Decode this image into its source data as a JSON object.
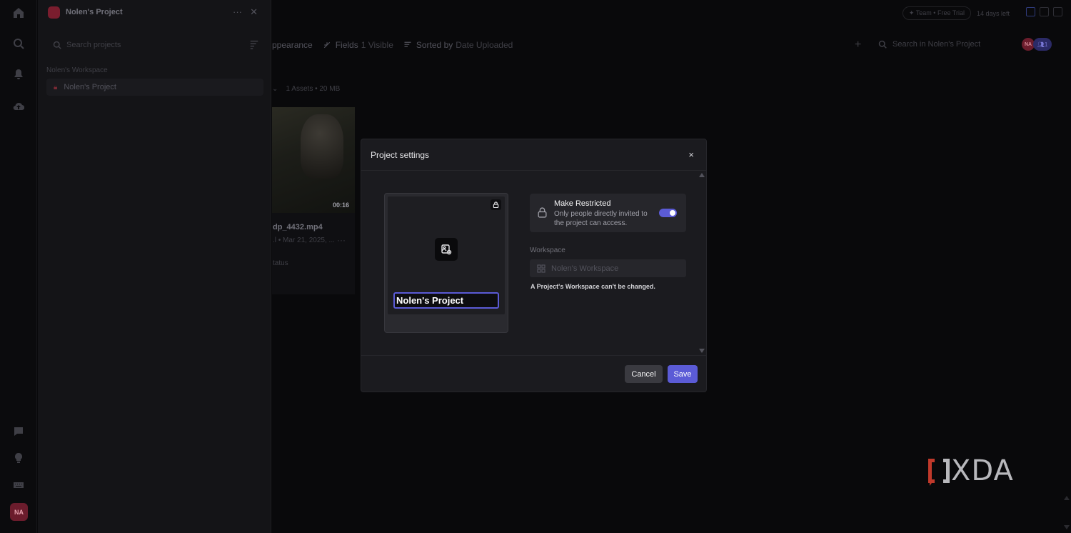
{
  "sidebar": {
    "project_title": "Nolen's Project",
    "search_placeholder": "Search projects",
    "workspace_label": "Nolen's Workspace",
    "items": [
      {
        "label": "Nolen's Project"
      }
    ]
  },
  "rail": {
    "avatar_initials": "NA"
  },
  "topbar": {
    "trial_label": "✦ Team • Free Trial",
    "days_left": "14 days left"
  },
  "toolbar": {
    "appearance_label": "ppearance",
    "fields_label": "Fields",
    "fields_value": "1 Visible",
    "sorted_label": "Sorted by",
    "sorted_value": "Date Uploaded",
    "search_placeholder": "Search in Nolen's Project",
    "avatar_initials": "NA",
    "members_count": "1"
  },
  "content": {
    "asset_meta": "1 Assets • 20 MB",
    "asset_chevron": "⌄",
    "card": {
      "duration": "00:16",
      "name": "dp_4432.mp4",
      "subtitle": ".l • Mar 21, 2025, ...",
      "status": "tatus"
    }
  },
  "modal": {
    "title": "Project settings",
    "close_glyph": "×",
    "project_name_value": "Nolen's Project",
    "restricted": {
      "title": "Make Restricted",
      "description": "Only people directly invited to the project can access.",
      "enabled": true
    },
    "workspace_label": "Workspace",
    "workspace_value": "Nolen's Workspace",
    "workspace_note": "A Project's Workspace can't be changed.",
    "cancel_label": "Cancel",
    "save_label": "Save"
  },
  "watermark": {
    "text": "XDA"
  },
  "colors": {
    "accent": "#5b5bd6",
    "brand_red": "#7a1d2e",
    "modal_bg": "#1b1b1f"
  }
}
